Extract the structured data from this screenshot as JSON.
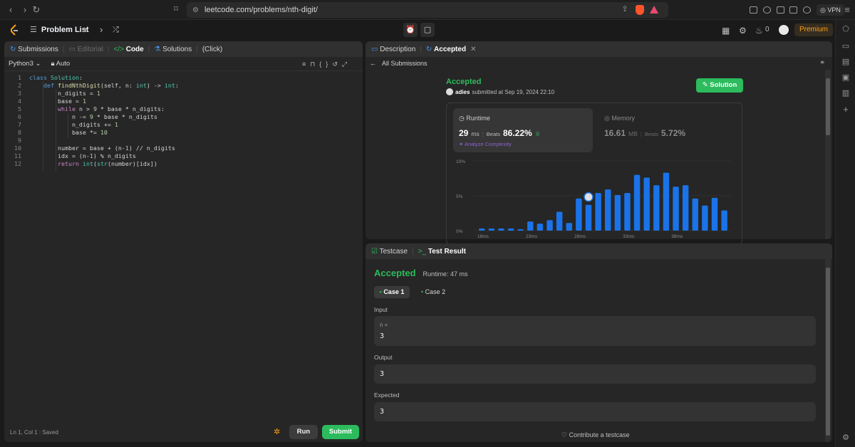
{
  "browser": {
    "url": "leetcode.com/problems/nth-digit/",
    "vpn_label": "VPN"
  },
  "nav": {
    "problem_list": "Problem List",
    "fire_count": "0",
    "premium": "Premium"
  },
  "left_panel": {
    "tabs": [
      {
        "label": "Submissions",
        "active": false
      },
      {
        "label": "Editorial",
        "active": false,
        "dim": true
      },
      {
        "label": "Code",
        "active": true
      },
      {
        "label": "Solutions",
        "active": false
      },
      {
        "label": "(Click)",
        "active": false
      }
    ],
    "language": "Python3",
    "auto_label": "Auto",
    "code_lines": [
      "class Solution:",
      "    def findNthDigit(self, n: int) -> int:",
      "        n_digits = 1",
      "        base = 1",
      "        while n > 9 * base * n_digits:",
      "            n -= 9 * base * n_digits",
      "            n_digits += 1",
      "            base *= 10",
      "",
      "        number = base + (n-1) // n_digits",
      "        idx = (n-1) % n_digits",
      "        return int(str(number)[idx])"
    ],
    "status_position": "Ln 1, Col 1",
    "status_saved": "Saved",
    "run_label": "Run",
    "submit_label": "Submit"
  },
  "submission_panel": {
    "tabs": [
      {
        "label": "Description"
      },
      {
        "label": "Accepted"
      }
    ],
    "back_label": "All Submissions",
    "status": "Accepted",
    "user": "adies",
    "submitted_text": "submitted at Sep 19, 2024 22:10",
    "solution_label": "Solution",
    "runtime": {
      "label": "Runtime",
      "value": "29",
      "unit": "ms",
      "beats_label": "Beats",
      "beats_value": "86.22%",
      "analyze_label": "Analyze Complexity"
    },
    "memory": {
      "label": "Memory",
      "value": "16.61",
      "unit": "MB",
      "beats_label": "Beats",
      "beats_value": "5.72%"
    }
  },
  "chart_data": {
    "type": "bar",
    "y_ticks": [
      "10%",
      "5%",
      "0%"
    ],
    "ylim": [
      0,
      10
    ],
    "x_ticks": [
      "18ms",
      "23ms",
      "28ms",
      "33ms",
      "38ms"
    ],
    "values": [
      0.3,
      0.3,
      0.3,
      0.3,
      0.2,
      1.3,
      1.0,
      1.5,
      2.7,
      1.1,
      4.6,
      3.7,
      5.4,
      5.9,
      5.1,
      5.4,
      8.0,
      7.6,
      6.5,
      8.3,
      6.3,
      6.5,
      4.6,
      3.6,
      4.7,
      2.9
    ],
    "highlight_index": 11,
    "bar_color": "#1a73e8"
  },
  "test_panel": {
    "tabs": [
      {
        "label": "Testcase"
      },
      {
        "label": "Test Result"
      }
    ],
    "status": "Accepted",
    "runtime_text": "Runtime: 47 ms",
    "cases": [
      "Case 1",
      "Case 2"
    ],
    "input_label": "Input",
    "input_var": "n =",
    "input_value": "3",
    "output_label": "Output",
    "output_value": "3",
    "expected_label": "Expected",
    "expected_value": "3",
    "contribute_label": "Contribute a testcase"
  },
  "colors": {
    "accent_green": "#2cbb5d",
    "premium": "#ffa116",
    "bar_blue": "#1a73e8"
  }
}
